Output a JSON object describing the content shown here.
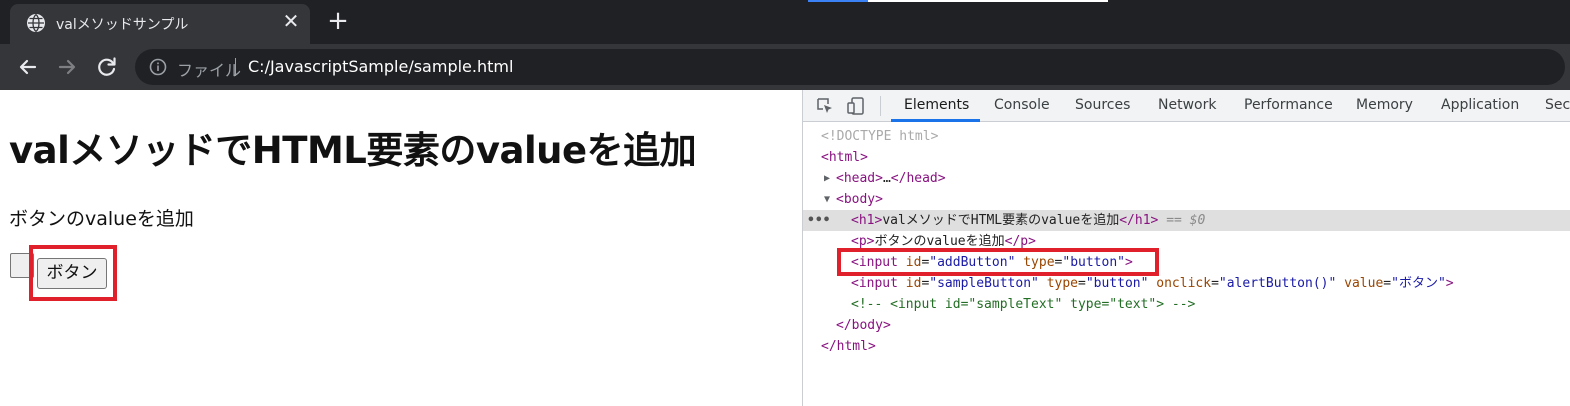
{
  "browser": {
    "tab_title": "valメソッドサンプル",
    "tab_close": "✕",
    "new_tab": "+",
    "scheme_label": "ファイル",
    "url": "C:/JavascriptSample/sample.html"
  },
  "page": {
    "heading": "valメソッドでHTML要素のvalueを追加",
    "paragraph": "ボタンのvalueを追加",
    "button_label": "ボタン"
  },
  "devtools": {
    "tabs": [
      "Elements",
      "Console",
      "Sources",
      "Network",
      "Performance",
      "Memory",
      "Application",
      "Sec"
    ],
    "active_tab": "Elements",
    "dom": {
      "doctype": "<!DOCTYPE html>",
      "html_open": "html",
      "head_tag": "head",
      "head_ellipsis": "…",
      "body_tag": "body",
      "h1_tag": "h1",
      "h1_text": "valメソッドでHTML要素のvalueを追加",
      "selected_marker": "== $0",
      "p_tag": "p",
      "p_text": "ボタンのvalueを追加",
      "input_tag": "input",
      "line1_attrs": [
        {
          "name": "id",
          "value": "addButton"
        },
        {
          "name": "type",
          "value": "button"
        }
      ],
      "line2_attrs": [
        {
          "name": "id",
          "value": "sampleButton"
        },
        {
          "name": "type",
          "value": "button"
        },
        {
          "name": "onclick",
          "value": "alertButton()"
        },
        {
          "name": "value",
          "value": "ボタン"
        }
      ],
      "comment": "<!-- <input id=\"sampleText\" type=\"text\"> -->",
      "dots": "•••"
    }
  },
  "colors": {
    "highlight": "#e0202a",
    "active_tab": "#1a73e8"
  }
}
